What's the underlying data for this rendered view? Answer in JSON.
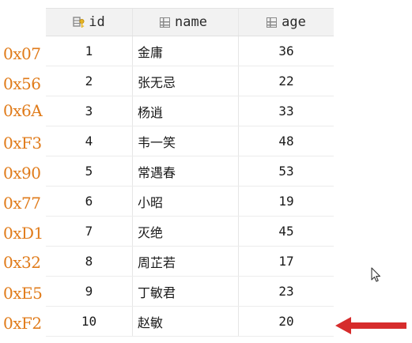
{
  "annotations": {
    "addresses": [
      "0x07",
      "0x56",
      "0x6A",
      "0xF3",
      "0x90",
      "0x77",
      "0xD1",
      "0x32",
      "0xE5",
      "0xF2"
    ],
    "color": "#e07b1a",
    "arrow_color": "#d62c2c"
  },
  "table": {
    "columns": [
      {
        "label": "id",
        "icon": "primary-key-column-icon"
      },
      {
        "label": "name",
        "icon": "column-icon"
      },
      {
        "label": "age",
        "icon": "column-icon"
      }
    ],
    "rows": [
      {
        "id": "1",
        "name": "金庸",
        "age": "36"
      },
      {
        "id": "2",
        "name": "张无忌",
        "age": "22"
      },
      {
        "id": "3",
        "name": "杨逍",
        "age": "33"
      },
      {
        "id": "4",
        "name": "韦一笑",
        "age": "48"
      },
      {
        "id": "5",
        "name": "常遇春",
        "age": "53"
      },
      {
        "id": "6",
        "name": "小昭",
        "age": "19"
      },
      {
        "id": "7",
        "name": "灭绝",
        "age": "45"
      },
      {
        "id": "8",
        "name": "周芷若",
        "age": "17"
      },
      {
        "id": "9",
        "name": "丁敏君",
        "age": "23"
      },
      {
        "id": "10",
        "name": "赵敏",
        "age": "20"
      }
    ]
  }
}
